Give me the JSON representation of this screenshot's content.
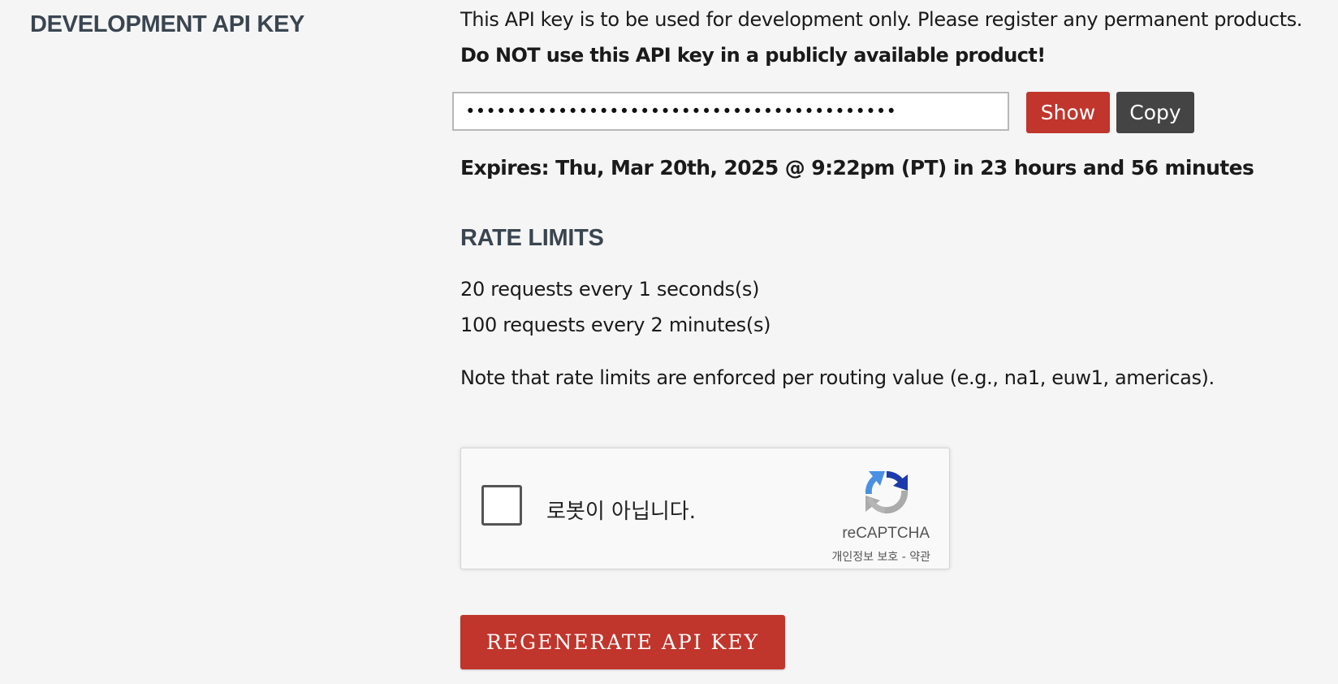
{
  "section": {
    "title": "DEVELOPMENT API KEY"
  },
  "api_key": {
    "description": "This API key is to be used for development only. Please register any permanent products.",
    "warning": "Do NOT use this API key in a publicly available product!",
    "masked_value": "••••••••••••••••••••••••••••••••••••••••••",
    "show_label": "Show",
    "copy_label": "Copy",
    "expires": "Expires: Thu, Mar 20th, 2025 @ 9:22pm (PT) in 23 hours and 56 minutes"
  },
  "rate_limits": {
    "title": "RATE LIMITS",
    "lines": [
      "20 requests every 1 seconds(s)",
      "100 requests every 2 minutes(s)"
    ],
    "note": "Note that rate limits are enforced per routing value (e.g., na1, euw1, americas)."
  },
  "recaptcha": {
    "label": "로봇이 아닙니다.",
    "brand": "reCAPTCHA",
    "privacy_label": "개인정보 보호",
    "separator": " - ",
    "terms_label": "약관",
    "checked": false
  },
  "actions": {
    "regenerate_label": "REGENERATE API KEY"
  },
  "colors": {
    "background": "#f5f5f5",
    "heading": "#3a4550",
    "accent_red": "#c0362c",
    "dark_button": "#444444"
  }
}
